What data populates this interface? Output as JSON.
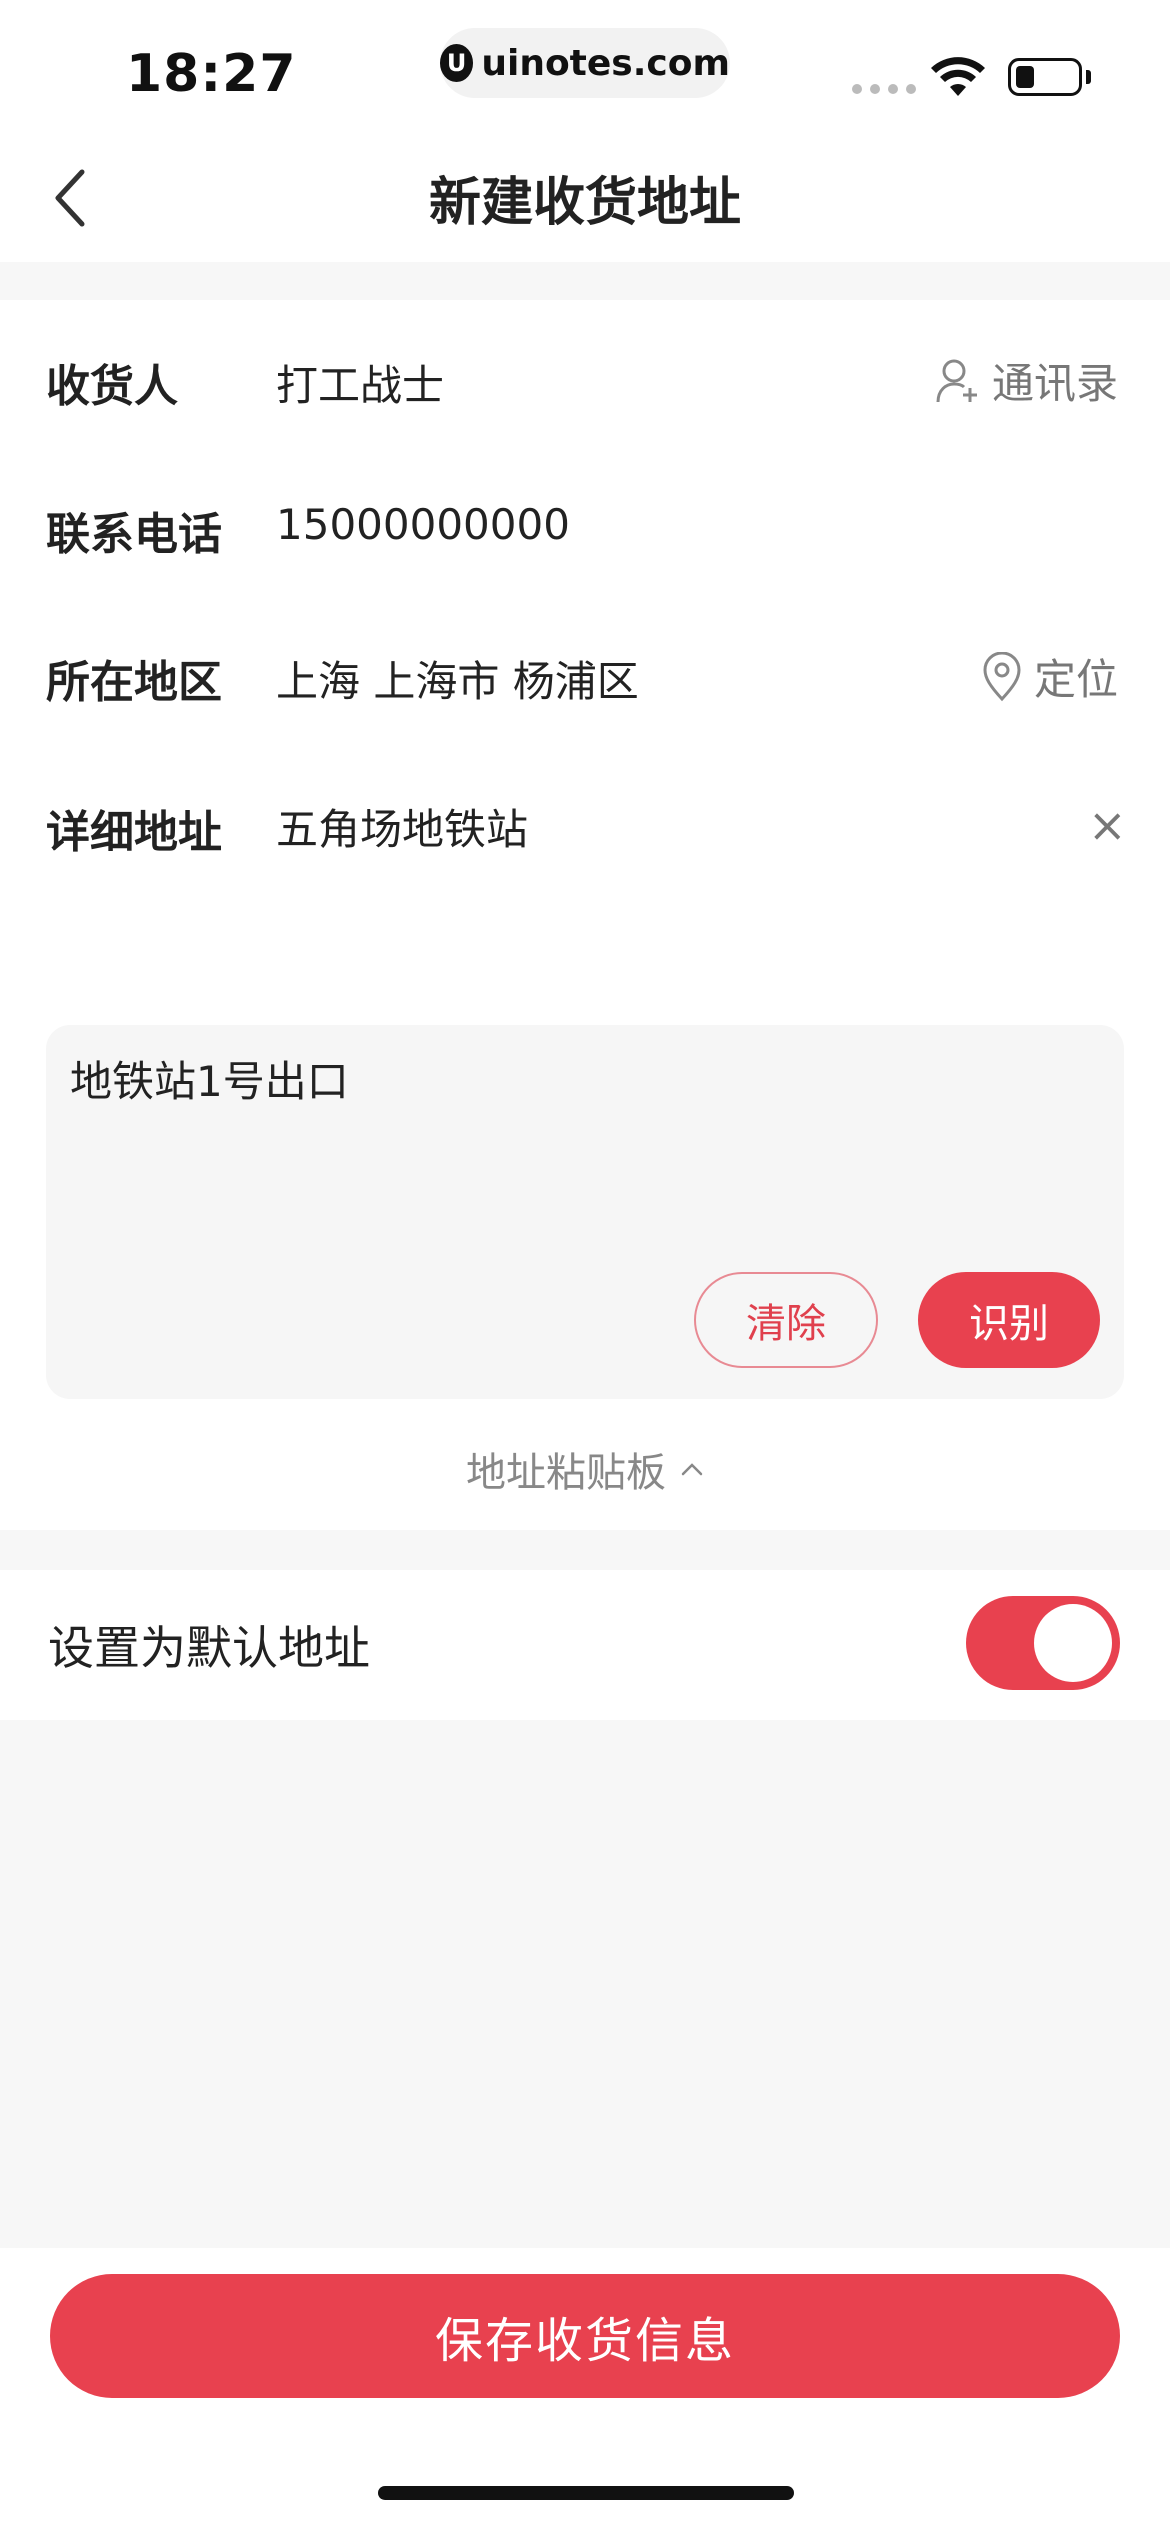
{
  "status_bar": {
    "time": "18:27",
    "url": "uinotes.com",
    "url_logo_char": "U"
  },
  "nav": {
    "title": "新建收货地址",
    "back_icon": "chevron-left-icon"
  },
  "form": {
    "receiver": {
      "label": "收货人",
      "value": "打工战士",
      "action": "通讯录"
    },
    "phone": {
      "label": "联系电话",
      "value": "15000000000"
    },
    "region": {
      "label": "所在地区",
      "value": "上海 上海市 杨浦区",
      "action": "定位"
    },
    "address": {
      "label": "详细地址",
      "value": "五角场地铁站",
      "clear_icon": "×"
    }
  },
  "clipboard": {
    "text": "地铁站1号出口",
    "clear_label": "清除",
    "recognize_label": "识别",
    "toggle_label": "地址粘贴板"
  },
  "default_address": {
    "label": "设置为默认地址",
    "enabled": true
  },
  "footer": {
    "save_label": "保存收货信息"
  },
  "colors": {
    "accent": "#e8414f",
    "page_bg": "#f7f7f7",
    "muted": "#777777"
  }
}
